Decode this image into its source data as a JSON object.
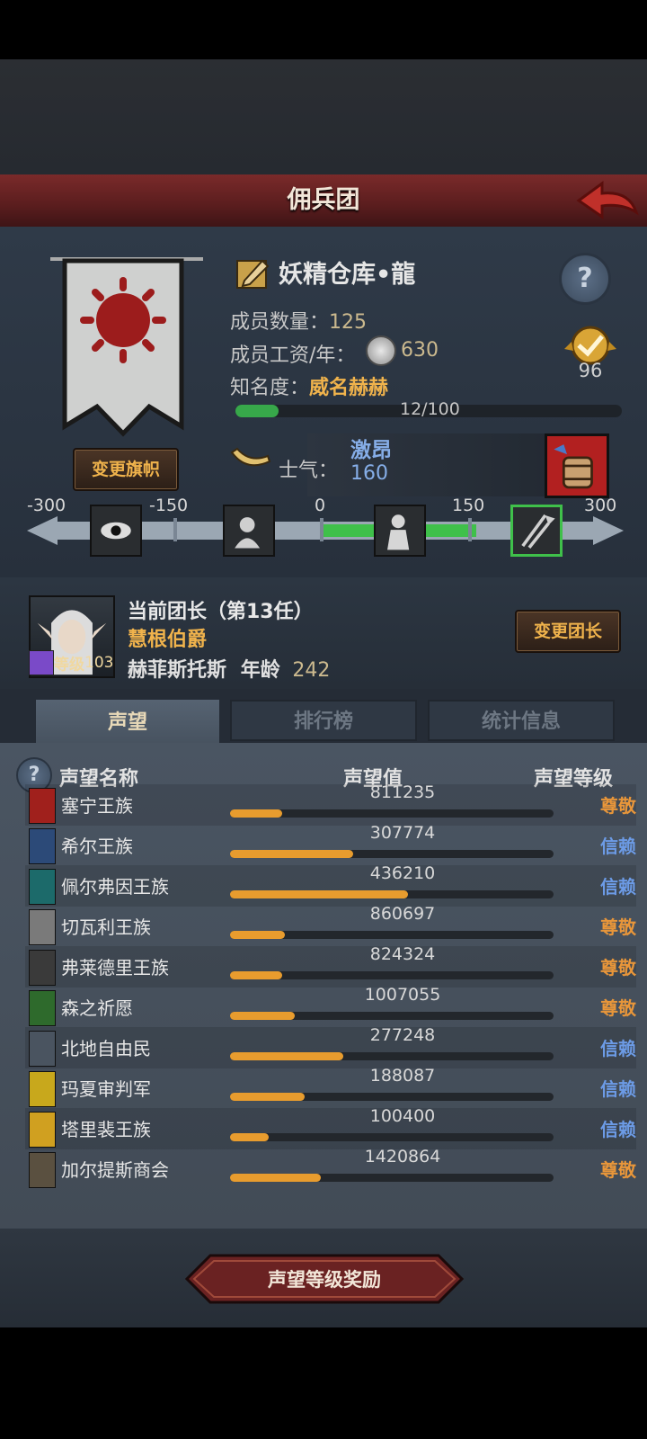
{
  "header": {
    "title": "佣兵团"
  },
  "guild": {
    "name": "妖精仓库•龍",
    "members_label": "成员数量：",
    "members_value": "125",
    "salary_label": "成员工资/年：",
    "salary_value": "630",
    "fame_label": "知名度：",
    "fame_value": "威名赫赫",
    "fame_progress_text": "12/100",
    "fame_progress": 0.12,
    "badge_value": "96",
    "change_flag_label": "变更旗帜"
  },
  "morale": {
    "label": "士气：",
    "state": "激昂",
    "value": "160",
    "scale_ticks": [
      "-300",
      "-150",
      "0",
      "150",
      "300"
    ]
  },
  "leader": {
    "title": "当前团长（第13任）",
    "rank": "慧根伯爵",
    "name": "赫菲斯托斯",
    "age_label": "年龄",
    "age_value": "242",
    "level_label": "等级",
    "level_value": "103",
    "change_label": "变更团长"
  },
  "tabs": [
    {
      "label": "声望",
      "active": true
    },
    {
      "label": "排行榜",
      "active": false
    },
    {
      "label": "统计信息",
      "active": false
    }
  ],
  "reputation_header": {
    "name": "声望名称",
    "value": "声望值",
    "level": "声望等级"
  },
  "reputation": [
    {
      "name": "塞宁王族",
      "value": "811235",
      "fill": 0.16,
      "level": "尊敬",
      "level_color": "#e8963a",
      "icon_color": "#a0201c"
    },
    {
      "name": "希尔王族",
      "value": "307774",
      "fill": 0.38,
      "level": "信赖",
      "level_color": "#6c9be6",
      "icon_color": "#2c4a78"
    },
    {
      "name": "佩尔弗因王族",
      "value": "436210",
      "fill": 0.55,
      "level": "信赖",
      "level_color": "#6c9be6",
      "icon_color": "#1c6a6a"
    },
    {
      "name": "切瓦利王族",
      "value": "860697",
      "fill": 0.17,
      "level": "尊敬",
      "level_color": "#e8963a",
      "icon_color": "#7a7a7a"
    },
    {
      "name": "弗莱德里王族",
      "value": "824324",
      "fill": 0.16,
      "level": "尊敬",
      "level_color": "#e8963a",
      "icon_color": "#3a3a3a"
    },
    {
      "name": "森之祈愿",
      "value": "1007055",
      "fill": 0.2,
      "level": "尊敬",
      "level_color": "#e8963a",
      "icon_color": "#2e6a2c"
    },
    {
      "name": "北地自由民",
      "value": "277248",
      "fill": 0.35,
      "level": "信赖",
      "level_color": "#6c9be6",
      "icon_color": "#4a5460"
    },
    {
      "name": "玛夏审判军",
      "value": "188087",
      "fill": 0.23,
      "level": "信赖",
      "level_color": "#6c9be6",
      "icon_color": "#c8a81c"
    },
    {
      "name": "塔里裴王族",
      "value": "100400",
      "fill": 0.12,
      "level": "信赖",
      "level_color": "#6c9be6",
      "icon_color": "#d0a020"
    },
    {
      "name": "加尔提斯商会",
      "value": "1420864",
      "fill": 0.28,
      "level": "尊敬",
      "level_color": "#e8963a",
      "icon_color": "#5a5040"
    }
  ],
  "footer": {
    "reward_label": "声望等级奖励"
  }
}
